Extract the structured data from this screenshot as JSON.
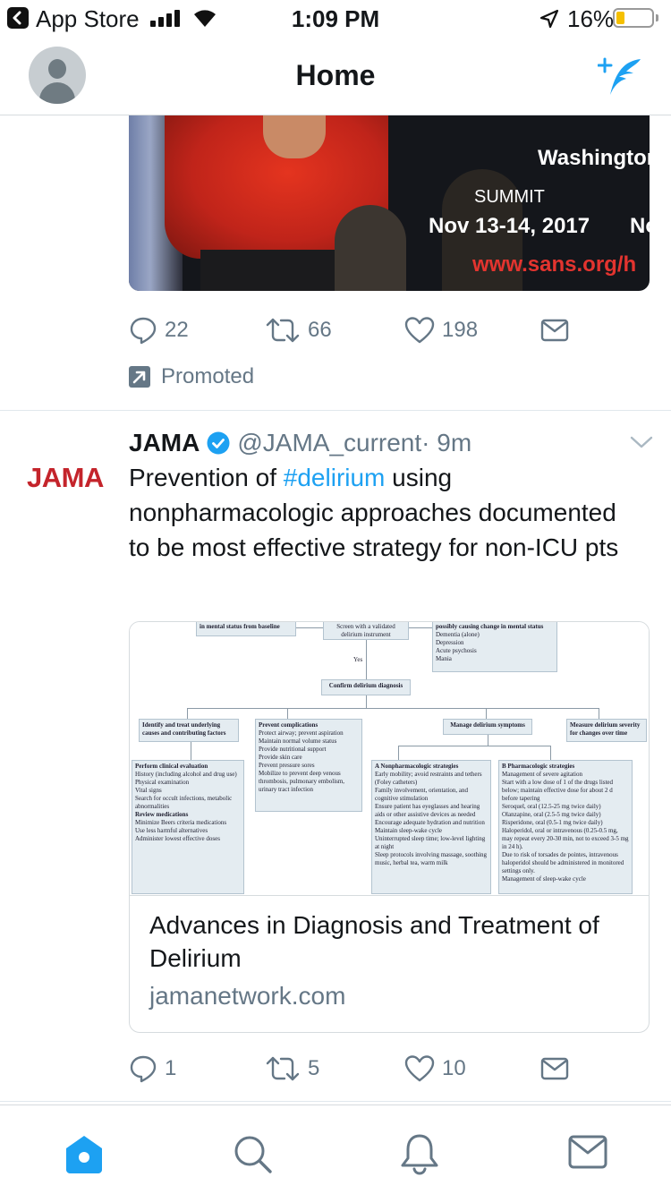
{
  "status_bar": {
    "back_app": "App Store",
    "time": "1:09 PM",
    "battery": "16%"
  },
  "nav": {
    "title": "Home",
    "avatar_icon": "default-avatar-icon",
    "compose_icon": "compose-tweet-icon"
  },
  "tweet1": {
    "media": {
      "city": "Washington",
      "event": "SUMMIT",
      "dates": "Nov 13-14, 2017",
      "dates_next": "No",
      "url": "www.sans.org/h"
    },
    "actions": {
      "replies": "22",
      "retweets": "66",
      "likes": "198"
    },
    "promoted": "Promoted"
  },
  "tweet2": {
    "logo": "JAMA",
    "name": "JAMA",
    "handle": "@JAMA_current",
    "time": "· 9m",
    "text_before": "Prevention of ",
    "hashtag": "#delirium",
    "text_after": " using nonpharmacologic approaches documented to be most effective strategy for non-ICU pts",
    "card": {
      "title": "Advances in Diagnosis and Treatment of Delirium",
      "domain": "jamanetwork.com",
      "flowchart": {
        "top_left": "in mental status from baseline",
        "screen": "Screen with a validated delirium instrument",
        "yes": "Yes",
        "causing": "possibly causing change in mental status",
        "causing_items": [
          "Dementia (alone)",
          "Depression",
          "Acute psychosis",
          "Mania"
        ],
        "confirm": "Confirm delirium diagnosis",
        "identify": "Identify and treat underlying causes and contributing factors",
        "prevent_title": "Prevent complications",
        "prevent_items": [
          "Protect airway; prevent aspiration",
          "Maintain normal volume status",
          "Provide nutritional support",
          "Provide skin care",
          "Prevent pressure sores",
          "Mobilize to prevent deep venous thrombosis, pulmonary embolism, urinary tract infection"
        ],
        "manage": "Manage delirium symptoms",
        "measure": "Measure delirium severity for changes over time",
        "eval_title": "Perform clinical evaluation",
        "eval_items": [
          "History (including alcohol and drug use)",
          "Physical examination",
          "Vital signs",
          "Search for occult infections, metabolic abnormalities"
        ],
        "review_title": "Review medications",
        "review_items": [
          "Minimize Beers criteria medications",
          "Use less harmful alternatives",
          "Administer lowest effective doses"
        ],
        "nonpharm_label": "A",
        "nonpharm_title": "Nonpharmacologic strategies",
        "nonpharm_items": [
          "Early mobility; avoid restraints and tethers (Foley catheters)",
          "Family involvement, orientation, and cognitive stimulation",
          "Ensure patient has eyeglasses and hearing aids or other assistive devices as needed",
          "Encourage adequate hydration and nutrition",
          "Maintain sleep-wake cycle",
          "Uninterrupted sleep time; low-level lighting at night",
          "Sleep protocols involving massage, soothing music, herbal tea, warm milk"
        ],
        "pharm_label": "B",
        "pharm_title": "Pharmacologic strategies",
        "pharm_items": [
          "Management of severe agitation",
          "Start with a low dose of 1 of the drugs listed below; maintain effective dose for about 2 d before tapering",
          "Seroquel, oral (12.5-25 mg twice daily)",
          "Olanzapine, oral (2.5-5 mg twice daily)",
          "Risperidone, oral (0.5-1 mg twice daily)",
          "Haloperidol, oral or intravenous (0.25-0.5 mg, may repeat every 20-30 min, not to exceed 3-5 mg in 24 h).",
          "Due to risk of torsades de pointes, intravenous haloperidol should be administered in monitored settings only.",
          "Management of sleep-wake cycle"
        ]
      }
    },
    "actions": {
      "replies": "1",
      "retweets": "5",
      "likes": "10"
    }
  },
  "tabbar": {
    "home_icon": "home-icon",
    "search_icon": "search-icon",
    "notifications_icon": "bell-icon",
    "messages_icon": "mail-icon",
    "active_color": "#1da1f2"
  }
}
